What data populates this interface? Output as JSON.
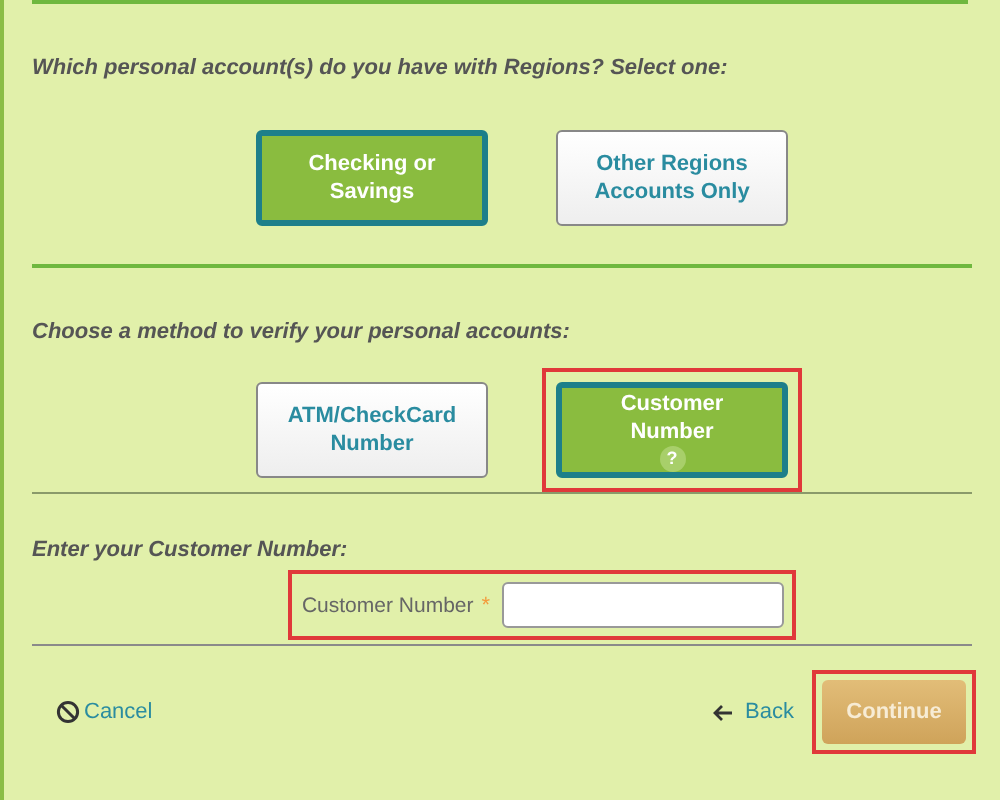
{
  "sections": [
    {
      "question": "Which personal account(s) do you have with Regions? Select one:",
      "options": [
        {
          "label": "Checking or Savings",
          "selected": true
        },
        {
          "label": "Other Regions Accounts Only",
          "selected": false
        }
      ]
    },
    {
      "question": "Choose a method to verify your personal accounts:",
      "options": [
        {
          "label": "ATM/CheckCard Number",
          "selected": false
        },
        {
          "label": "Customer Number",
          "selected": true,
          "highlighted": true,
          "help": true,
          "help_text": "?"
        }
      ]
    }
  ],
  "customer_number": {
    "question": "Enter your Customer Number:",
    "label": "Customer Number",
    "required_mark": "*",
    "highlighted": true
  },
  "footer": {
    "cancel": "Cancel",
    "back": "Back",
    "continue": {
      "label": "Continue",
      "disabled": true,
      "highlighted": true
    }
  }
}
